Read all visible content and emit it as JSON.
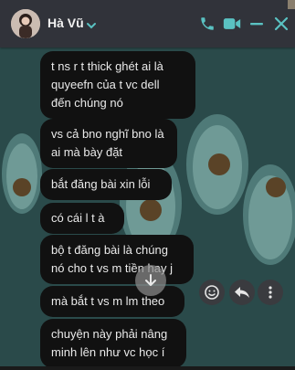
{
  "header": {
    "contact_name": "Hà Vũ",
    "icons": [
      "chevron-down-icon",
      "phone-icon",
      "video-icon",
      "minimize-icon",
      "close-icon"
    ],
    "accent_color": "#5ac2c2"
  },
  "messages": [
    {
      "text": "t ns r t thick ghét ai là\nquyeefn của t vc dell\nđến chúng nó"
    },
    {
      "text": "vs cả bno nghĩ bno là\nai mà bày đặt"
    },
    {
      "text": "bắt đăng bài xin lỗi"
    },
    {
      "text": "có cái l t à"
    },
    {
      "text": "bộ t đăng bài là chúng\nnó cho t vs m tiền hay j"
    },
    {
      "text": "mà bắt t vs m lm theo"
    },
    {
      "text": "chuyện này phải nâng\nminh lên như vc học í"
    }
  ],
  "actions": [
    "emoji-icon",
    "reply-icon",
    "more-icon"
  ],
  "colors": {
    "bubble": "#111111",
    "header": "#31333a",
    "wallpaper": "#2a4a4a",
    "avocado_skin": "#4f7a78",
    "avocado_flesh": "#6f9a96",
    "avocado_pit": "#5a4327"
  }
}
